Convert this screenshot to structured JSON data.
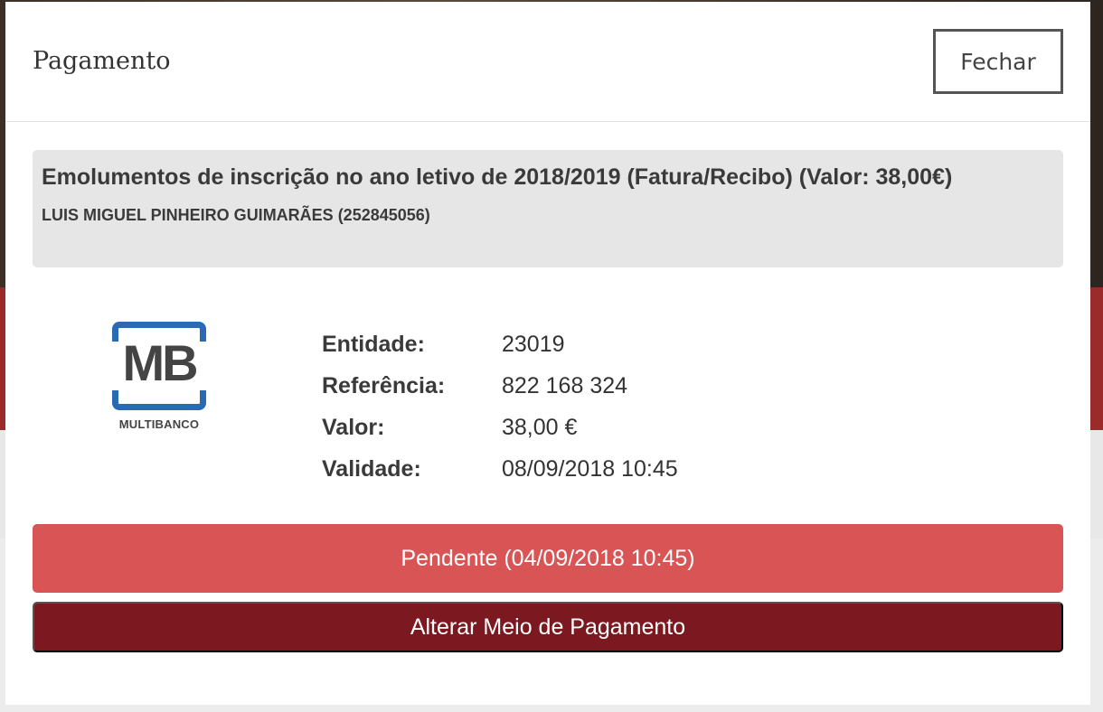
{
  "modal": {
    "title": "Pagamento",
    "close_label": "Fechar"
  },
  "summary": {
    "title": "Emolumentos de inscrição no ano letivo de 2018/2019 (Fatura/Recibo) (Valor: 38,00€)",
    "holder": "LUIS MIGUEL PINHEIRO GUIMARÃES (252845056)"
  },
  "payment_method": {
    "logo_text": "MB",
    "logo_caption": "MULTIBANCO",
    "logo_icon": "multibanco-logo",
    "brand_color": "#2a6ab1"
  },
  "details": [
    {
      "label": "Entidade:",
      "value": "23019"
    },
    {
      "label": "Referência:",
      "value": "822 168 324"
    },
    {
      "label": "Valor:",
      "value": "38,00 €"
    },
    {
      "label": "Validade:",
      "value": "08/09/2018 10:45"
    }
  ],
  "status": {
    "label": "Pendente (04/09/2018 10:45)",
    "color": "#d95454"
  },
  "actions": {
    "change_method_label": "Alterar Meio de Pagamento",
    "change_method_color": "#7b1820"
  }
}
